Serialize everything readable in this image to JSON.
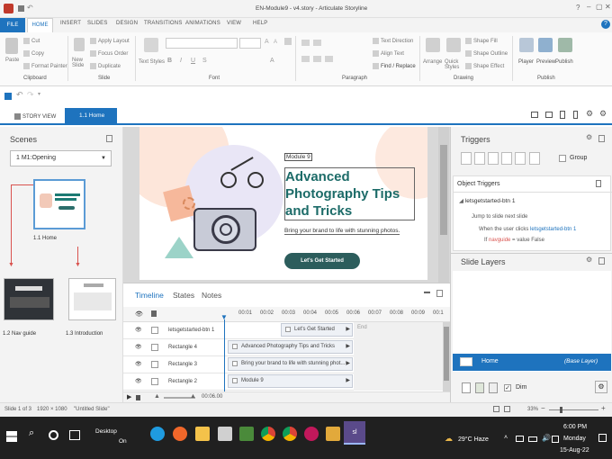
{
  "app": {
    "title": "EN-Module9 - v4.story - Articulate Storyline"
  },
  "ribbon": {
    "tabs": [
      "FILE",
      "HOME",
      "INSERT",
      "SLIDES",
      "DESIGN",
      "TRANSITIONS",
      "ANIMATIONS",
      "VIEW",
      "HELP"
    ],
    "paste": "Paste",
    "cut": "Cut",
    "copy": "Copy",
    "format_painter": "Format Painter",
    "clipboard": "Clipboard",
    "new_slide": "New Slide",
    "apply_layout": "Apply Layout",
    "focus_order": "Focus Order",
    "duplicate": "Duplicate",
    "slide_group": "Slide",
    "text_styles": "Text Styles",
    "font_group": "Font",
    "text_direction": "Text Direction",
    "align_text": "Align Text",
    "find_replace": "Find / Replace",
    "paragraph_group": "Paragraph",
    "arrange": "Arrange",
    "quick_styles": "Quick Styles",
    "shape_fill": "Shape Fill",
    "shape_outline": "Shape Outline",
    "shape_effect": "Shape Effect",
    "drawing_group": "Drawing",
    "player": "Player",
    "preview": "Preview",
    "publish": "Publish",
    "publish_group": "Publish"
  },
  "viewtabs": {
    "story_view": "STORY VIEW",
    "current": "1.1 Home"
  },
  "scenes": {
    "title": "Scenes",
    "dropdown": "1 M1:Opening",
    "thumbs": [
      "1.1 Home",
      "1.2 Nav guide",
      "1.3 Introduction"
    ]
  },
  "slide": {
    "module": "Module 9",
    "title": "Advanced Photography Tips and Tricks",
    "subtitle": "Bring your brand to life with stunning photos.",
    "button": "Let's Get Started"
  },
  "timeline": {
    "tabs": [
      "Timeline",
      "States",
      "Notes"
    ],
    "ticks": [
      "00:01",
      "00:02",
      "00:03",
      "00:04",
      "00:05",
      "00:06",
      "00:07",
      "00:08",
      "00:09",
      "00:1"
    ],
    "end": "End",
    "rows": [
      {
        "name": "letsgetstarted-btn 1",
        "bar": "Let's Get Started"
      },
      {
        "name": "Rectangle 4",
        "bar": "Advanced Photography Tips and Tricks"
      },
      {
        "name": "Rectangle 3",
        "bar": "Bring your brand to life with stunning phot..."
      },
      {
        "name": "Rectangle 2",
        "bar": "Module 9"
      }
    ],
    "time": "00:06.00"
  },
  "triggers": {
    "title": "Triggers",
    "group": "Group",
    "object_triggers": "Object Triggers",
    "object": "letsgetstarted-btn 1",
    "line1": "Jump to slide next slide",
    "line2_pre": "When the user clicks",
    "line2_link": "letsgetstarted-btn 1",
    "line3_pre": "If",
    "line3_link": "navguide",
    "line3_post": "= value False"
  },
  "layers": {
    "title": "Slide Layers",
    "home": "Home",
    "base": "(Base Layer)",
    "dim": "Dim"
  },
  "status": {
    "slide": "Slide 1 of 3",
    "size": "1920 × 1080",
    "theme": "\"Untitled Slide\"",
    "zoom": "33%"
  },
  "taskbar": {
    "desktop": "Desktop",
    "desktop_sub": "On",
    "weather": "29°C Haze",
    "time": "6:00 PM",
    "day": "Monday",
    "date": "15-Aug-22"
  }
}
